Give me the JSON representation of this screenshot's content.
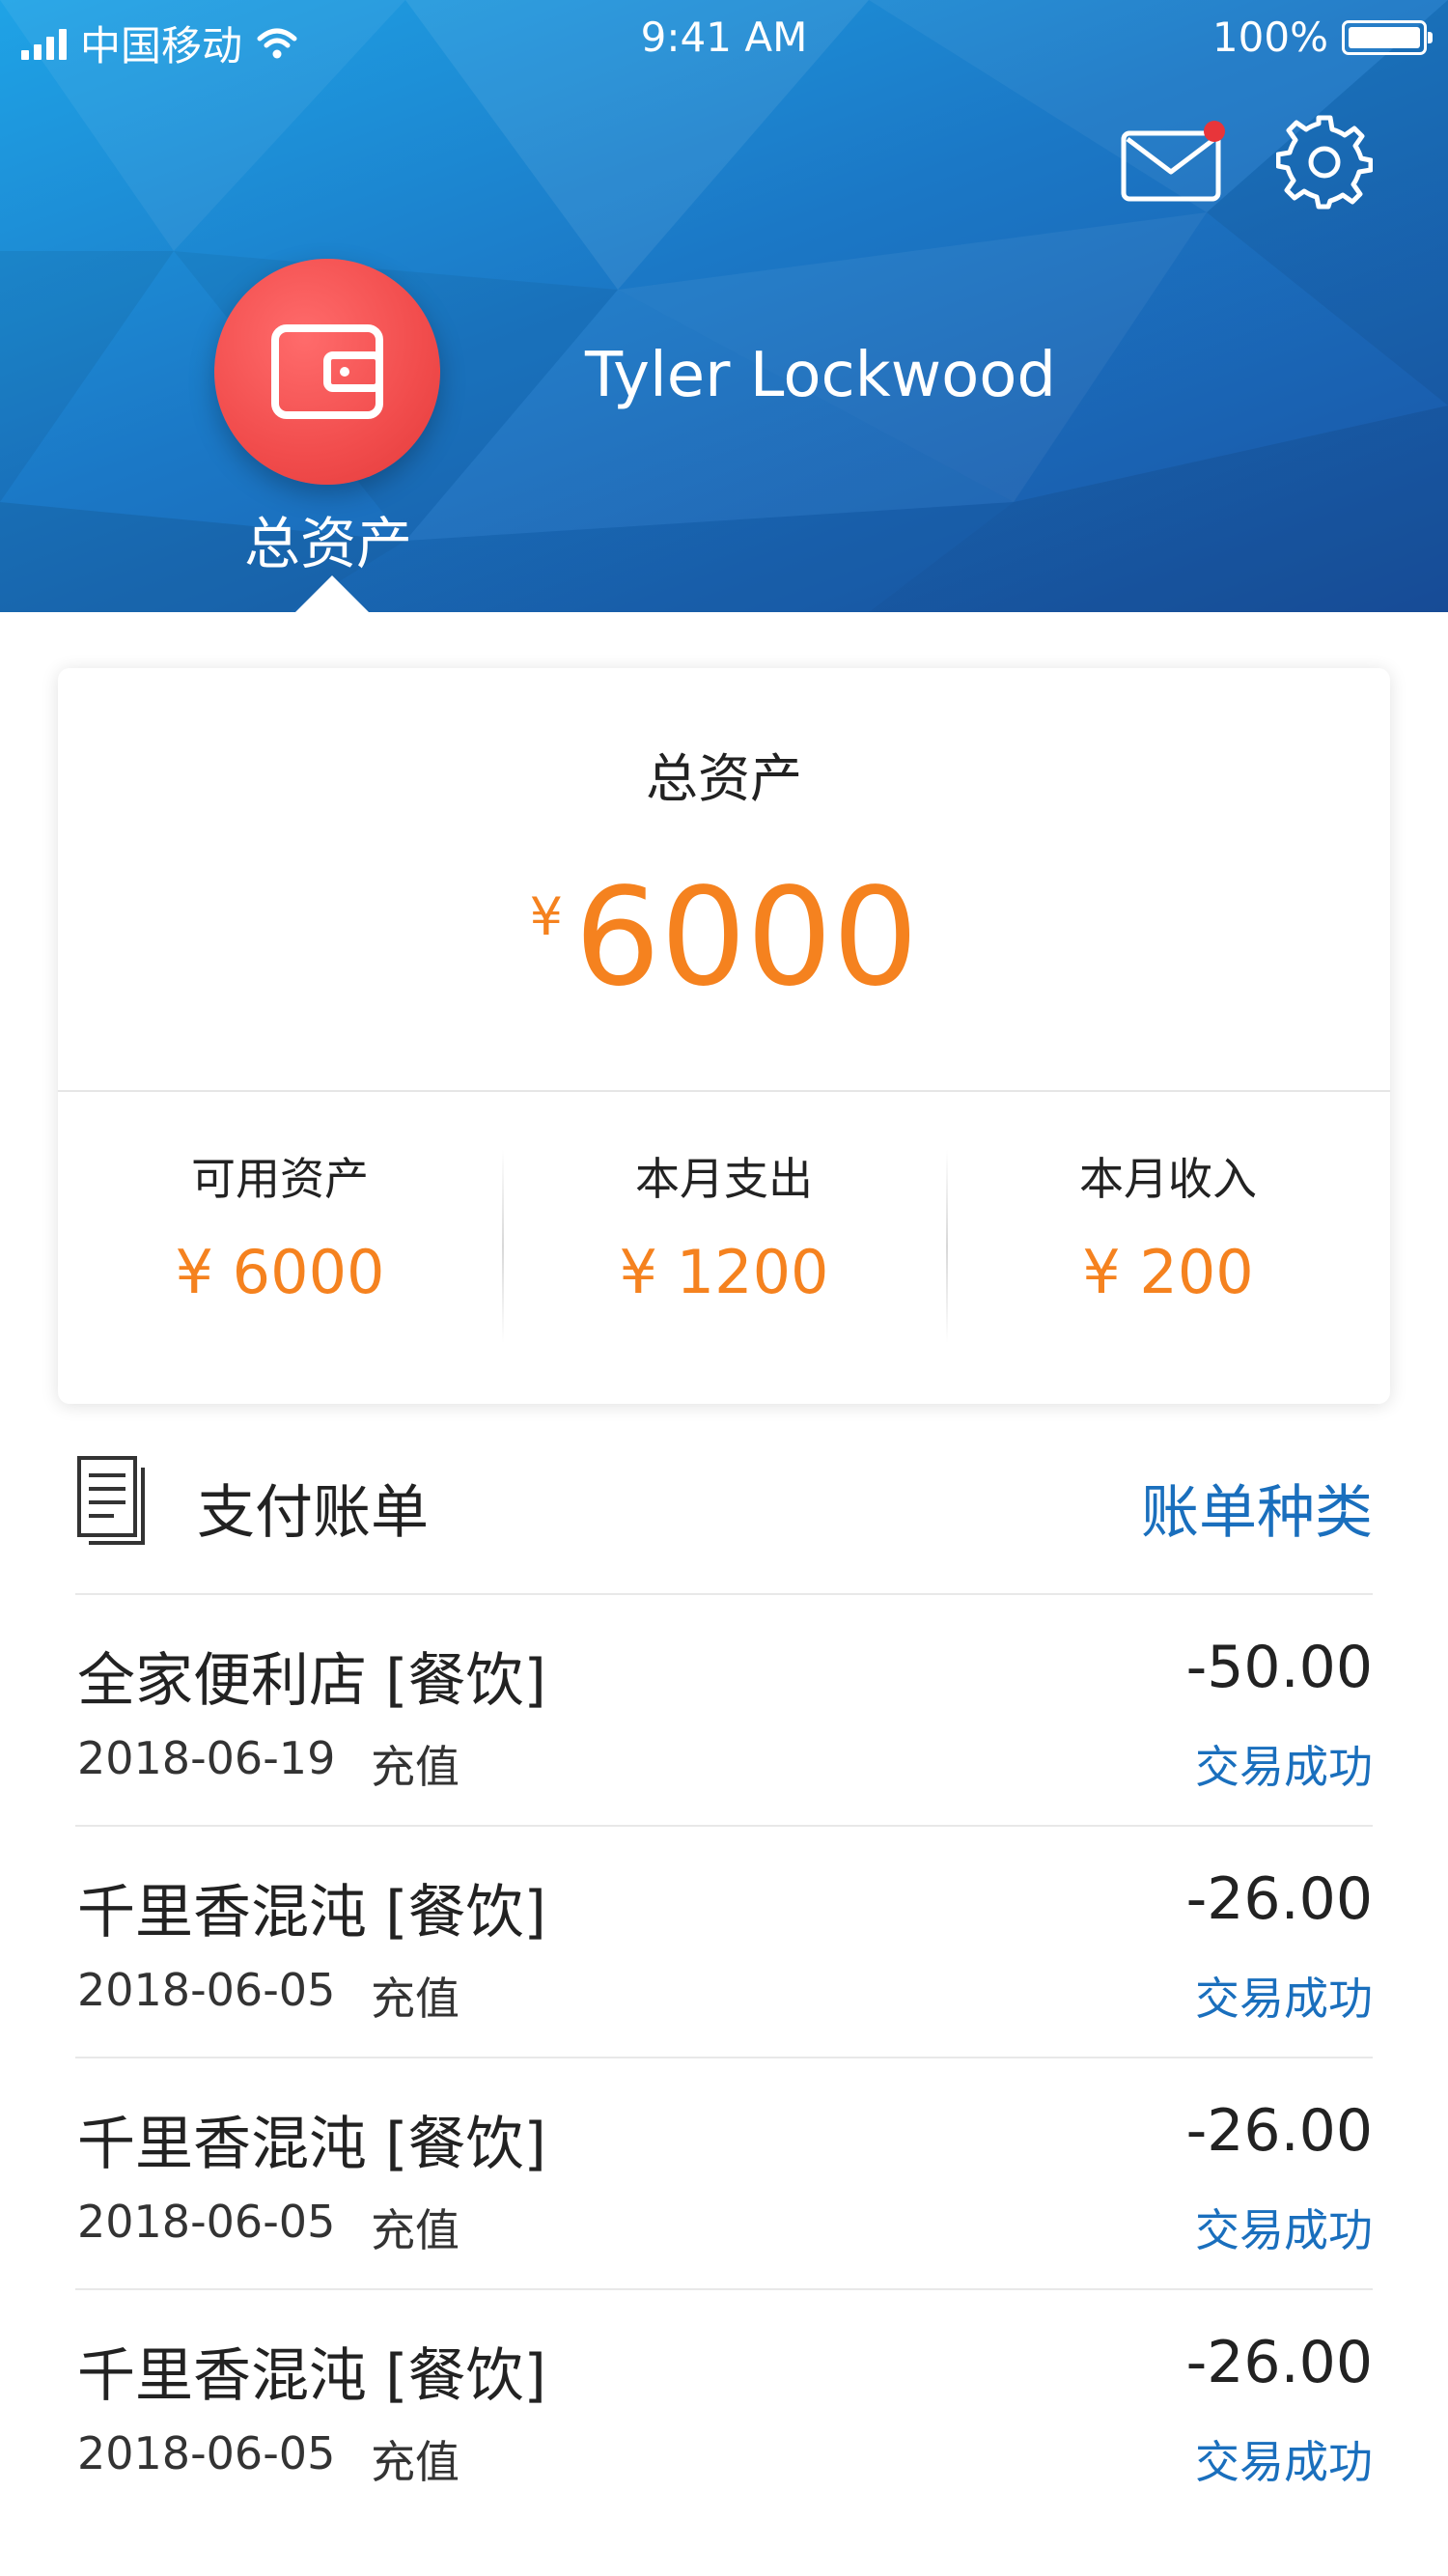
{
  "status_bar": {
    "carrier": "中国移动",
    "time": "9:41 AM",
    "battery": "100%"
  },
  "header": {
    "user_name": "Tyler Lockwood",
    "avatar_label": "总资产",
    "mail_icon": "mail-icon",
    "mail_has_notification": true,
    "settings_icon": "gear-icon"
  },
  "summary": {
    "title": "总资产",
    "currency": "¥",
    "total": "6000",
    "stats": [
      {
        "label": "可用资产",
        "value": "¥ 6000"
      },
      {
        "label": "本月支出",
        "value": "¥ 1200"
      },
      {
        "label": "本月收入",
        "value": "¥ 200"
      }
    ]
  },
  "bills": {
    "title": "支付账单",
    "category_link": "账单种类",
    "items": [
      {
        "name": "全家便利店 [餐饮]",
        "amount": "-50.00",
        "date": "2018-06-19",
        "type": "充值",
        "status": "交易成功"
      },
      {
        "name": "千里香混沌 [餐饮]",
        "amount": "-26.00",
        "date": "2018-06-05",
        "type": "充值",
        "status": "交易成功"
      },
      {
        "name": "千里香混沌 [餐饮]",
        "amount": "-26.00",
        "date": "2018-06-05",
        "type": "充值",
        "status": "交易成功"
      },
      {
        "name": "千里香混沌 [餐饮]",
        "amount": "-26.00",
        "date": "2018-06-05",
        "type": "充值",
        "status": "交易成功"
      }
    ]
  },
  "colors": {
    "header_blue": "#1b78c6",
    "accent_orange": "#f5821f",
    "link_blue": "#1a6fbd",
    "avatar_red": "#f14c4c",
    "notification_dot": "#e8353a"
  }
}
